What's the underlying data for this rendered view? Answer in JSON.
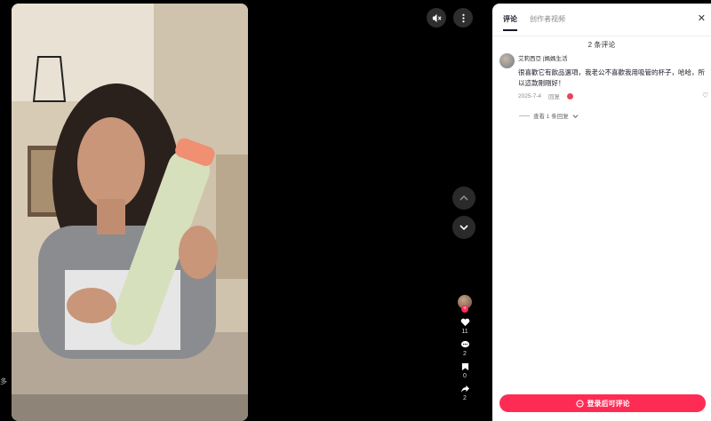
{
  "left_edge_text": "多",
  "player": {
    "mute_icon": "speaker-mute-icon",
    "more_icon": "more-vertical-icon",
    "prev_icon": "chevron-up-icon",
    "next_icon": "chevron-down-icon"
  },
  "actions": {
    "likes": "11",
    "comments": "2",
    "saves": "0",
    "shares": "2"
  },
  "panel": {
    "tabs": [
      "评论",
      "创作者视频"
    ],
    "comment_count": "2 条评论",
    "comments": [
      {
        "author": "艾莉西亞 |媽媽生活",
        "text": "很喜歡它有飲品選項，我老公不喜歡我用吸管的杯子，哈哈，所以這款剛剛好！",
        "date": "2025-7-4",
        "reply_label": "回复"
      }
    ],
    "view_replies": "查看 1 条回复",
    "login_button": "登录后可评论"
  },
  "colors": {
    "accent": "#fe2c55"
  }
}
